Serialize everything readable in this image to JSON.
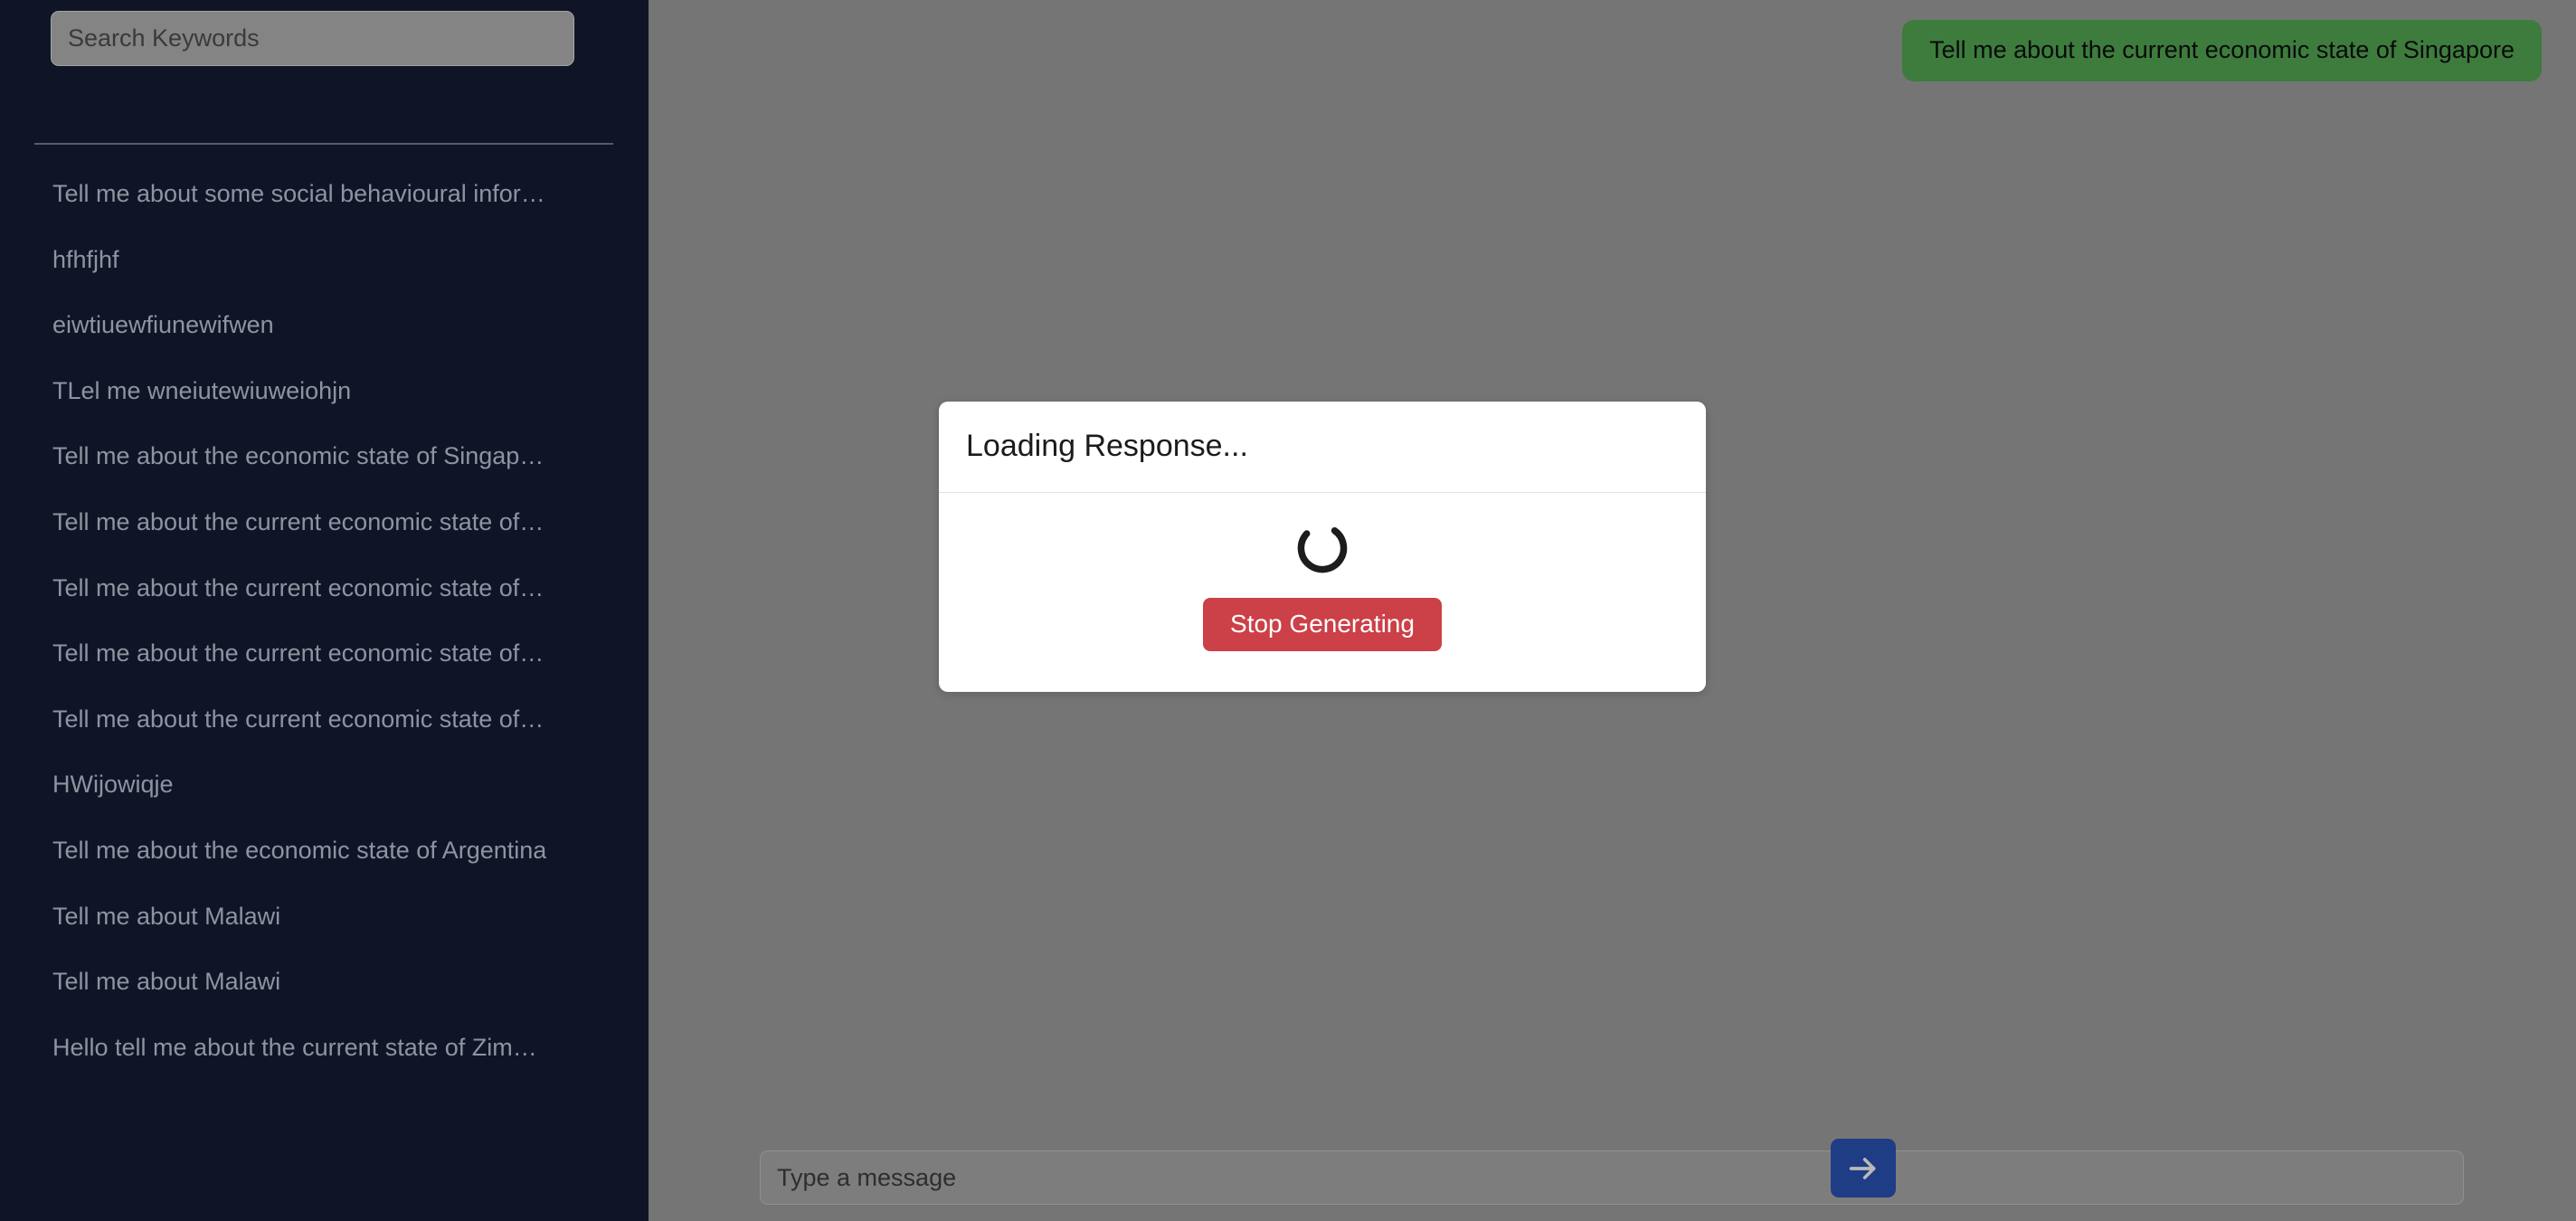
{
  "sidebar": {
    "search": {
      "placeholder": "Search Keywords",
      "value": ""
    },
    "history": [
      {
        "label": "Tell me about some social behavioural infor…"
      },
      {
        "label": "hfhfjhf"
      },
      {
        "label": "eiwtiuewfiunewifwen"
      },
      {
        "label": "TLel me wneiutewiuweiohjn"
      },
      {
        "label": "Tell me about the economic state of Singap…"
      },
      {
        "label": "Tell me about the current economic state of…"
      },
      {
        "label": "Tell me about the current economic state of…"
      },
      {
        "label": "Tell me about the current economic state of…"
      },
      {
        "label": "Tell me about the current economic state of…"
      },
      {
        "label": "HWijowiqje"
      },
      {
        "label": "Tell me about the economic state of Argentina"
      },
      {
        "label": "Tell me about Malawi"
      },
      {
        "label": "Tell me about Malawi"
      },
      {
        "label": "Hello tell me about the current state of Zim…"
      }
    ]
  },
  "chat": {
    "messages": [
      {
        "role": "user",
        "text": "Tell me about the current economic state of Singapore"
      }
    ]
  },
  "composer": {
    "input": {
      "placeholder": "Type a message",
      "value": ""
    },
    "send_icon": "arrow-right-icon"
  },
  "modal": {
    "title": "Loading Response...",
    "spinner_icon": "loading-spinner-icon",
    "stop_button_label": "Stop Generating"
  },
  "colors": {
    "sidebar_bg": "#0f1527",
    "sidebar_text": "#8e949f",
    "overlay_bg": "#757575",
    "user_bubble": "#3d7c3d",
    "send_button": "#1f3d85",
    "stop_button": "#cc4048",
    "modal_bg": "#ffffff"
  }
}
